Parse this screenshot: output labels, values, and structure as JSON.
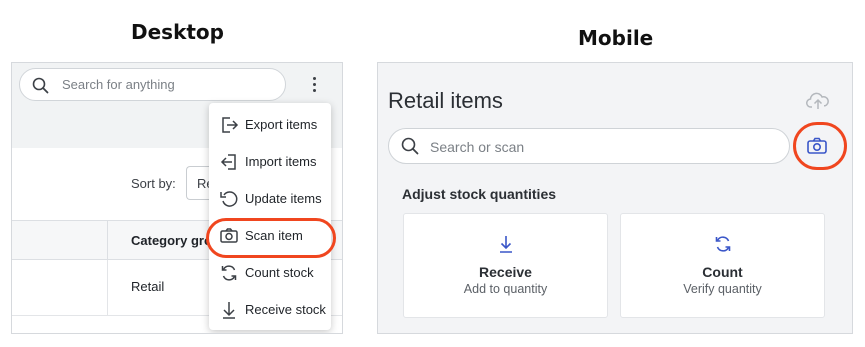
{
  "headings": {
    "desktop": "Desktop",
    "mobile": "Mobile"
  },
  "desktop": {
    "search_placeholder": "Search for anything",
    "sort_label": "Sort by:",
    "sort_value": "Re",
    "table_header": "Category gro",
    "table_cell": "Retail",
    "menu": [
      {
        "label": "Export items",
        "icon": "export-icon"
      },
      {
        "label": "Import items",
        "icon": "import-icon"
      },
      {
        "label": "Update items",
        "icon": "update-icon"
      },
      {
        "label": "Scan item",
        "icon": "camera-icon",
        "highlighted": true
      },
      {
        "label": "Count stock",
        "icon": "sync-icon"
      },
      {
        "label": "Receive stock",
        "icon": "arrow-down-icon"
      }
    ]
  },
  "mobile": {
    "title": "Retail items",
    "search_placeholder": "Search or scan",
    "section_title": "Adjust stock quantities",
    "cards": [
      {
        "title": "Receive",
        "subtitle": "Add to quantity",
        "icon": "arrow-down-icon"
      },
      {
        "title": "Count",
        "subtitle": "Verify quantity",
        "icon": "sync-icon"
      }
    ]
  },
  "colors": {
    "highlight": "#f0461f",
    "accent": "#3a56c8"
  }
}
